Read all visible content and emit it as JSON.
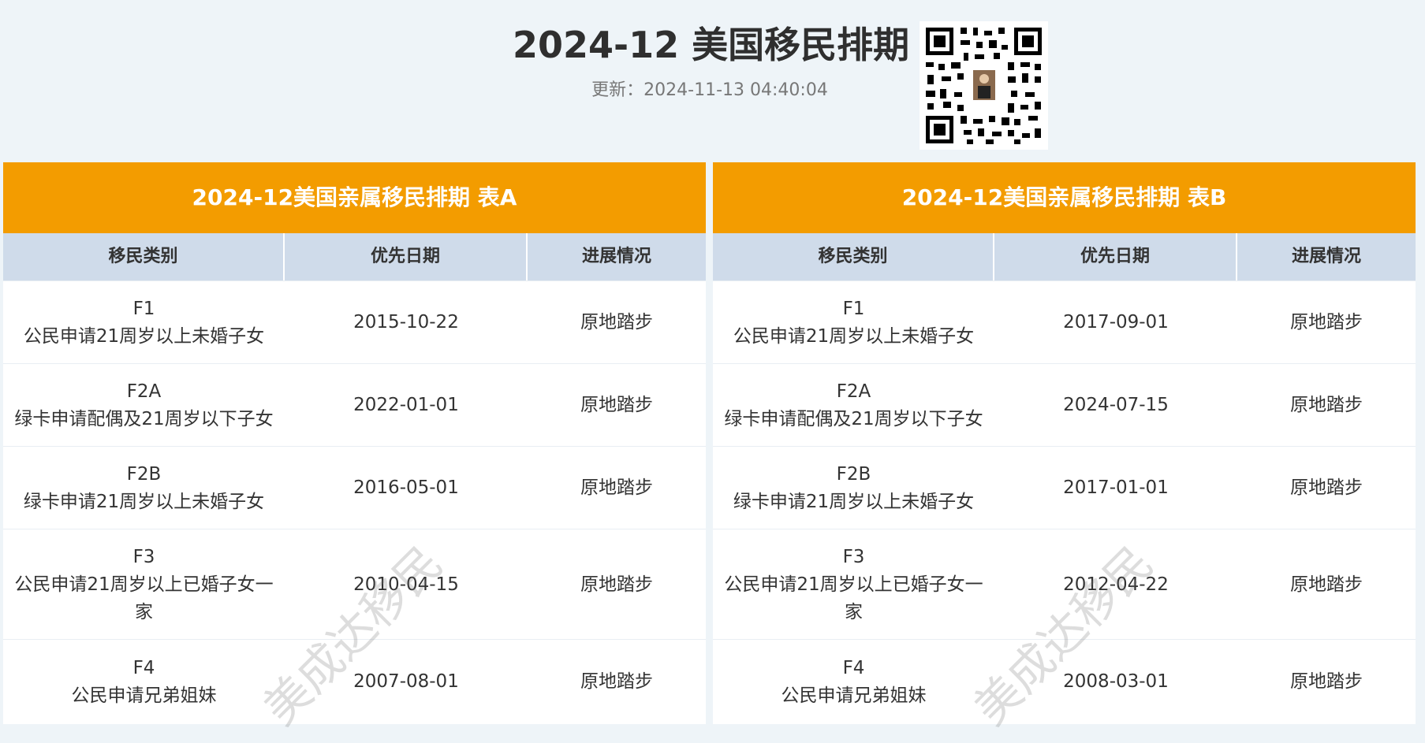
{
  "header": {
    "title": "2024-12 美国移民排期",
    "updated": "更新：2024-11-13 04:40:04"
  },
  "watermark": "美成达移民",
  "tables": [
    {
      "title": "2024-12美国亲属移民排期 表A",
      "headers": [
        "移民类别",
        "优先日期",
        "进展情况"
      ],
      "rows": [
        {
          "code": "F1",
          "desc": "公民申请21周岁以上未婚子女",
          "date": "2015-10-22",
          "status": "原地踏步"
        },
        {
          "code": "F2A",
          "desc": "绿卡申请配偶及21周岁以下子女",
          "date": "2022-01-01",
          "status": "原地踏步"
        },
        {
          "code": "F2B",
          "desc": "绿卡申请21周岁以上未婚子女",
          "date": "2016-05-01",
          "status": "原地踏步"
        },
        {
          "code": "F3",
          "desc": "公民申请21周岁以上已婚子女一家",
          "date": "2010-04-15",
          "status": "原地踏步"
        },
        {
          "code": "F4",
          "desc": "公民申请兄弟姐妹",
          "date": "2007-08-01",
          "status": "原地踏步"
        }
      ]
    },
    {
      "title": "2024-12美国亲属移民排期 表B",
      "headers": [
        "移民类别",
        "优先日期",
        "进展情况"
      ],
      "rows": [
        {
          "code": "F1",
          "desc": "公民申请21周岁以上未婚子女",
          "date": "2017-09-01",
          "status": "原地踏步"
        },
        {
          "code": "F2A",
          "desc": "绿卡申请配偶及21周岁以下子女",
          "date": "2024-07-15",
          "status": "原地踏步"
        },
        {
          "code": "F2B",
          "desc": "绿卡申请21周岁以上未婚子女",
          "date": "2017-01-01",
          "status": "原地踏步"
        },
        {
          "code": "F3",
          "desc": "公民申请21周岁以上已婚子女一家",
          "date": "2012-04-22",
          "status": "原地踏步"
        },
        {
          "code": "F4",
          "desc": "公民申请兄弟姐妹",
          "date": "2008-03-01",
          "status": "原地踏步"
        }
      ]
    }
  ],
  "colors": {
    "table_title_bg": "#f39c00",
    "column_header_bg": "#cfdbea",
    "page_bg": "#eef4f8"
  },
  "icons": {
    "qr": "qr-code-icon"
  }
}
